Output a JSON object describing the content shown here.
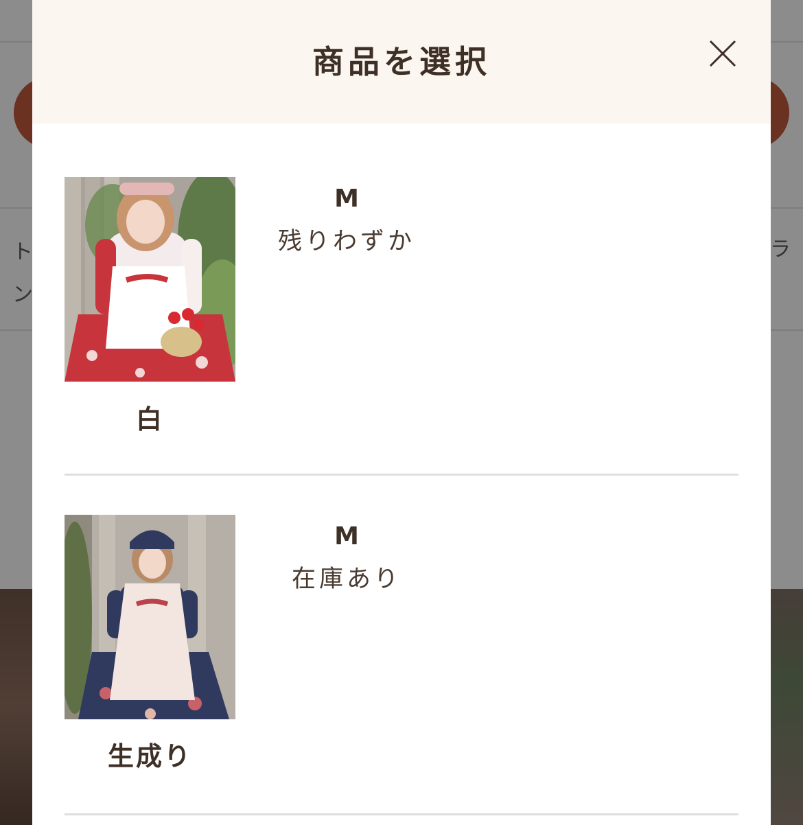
{
  "background": {
    "left_text": [
      "ト",
      "ン"
    ],
    "right_text": [
      "ラ"
    ]
  },
  "modal": {
    "title": "商品を選択",
    "close_label": "×"
  },
  "products": [
    {
      "color": "白",
      "size": "M",
      "stock": "残りわずか"
    },
    {
      "color": "生成り",
      "size": "M",
      "stock": "在庫あり"
    }
  ],
  "colors": {
    "header_bg": "#fbf6ef",
    "text_dark": "#3e3027",
    "accent_orange": "#b8553a",
    "divider": "#dedede"
  },
  "icons": {
    "close": "close-icon"
  }
}
